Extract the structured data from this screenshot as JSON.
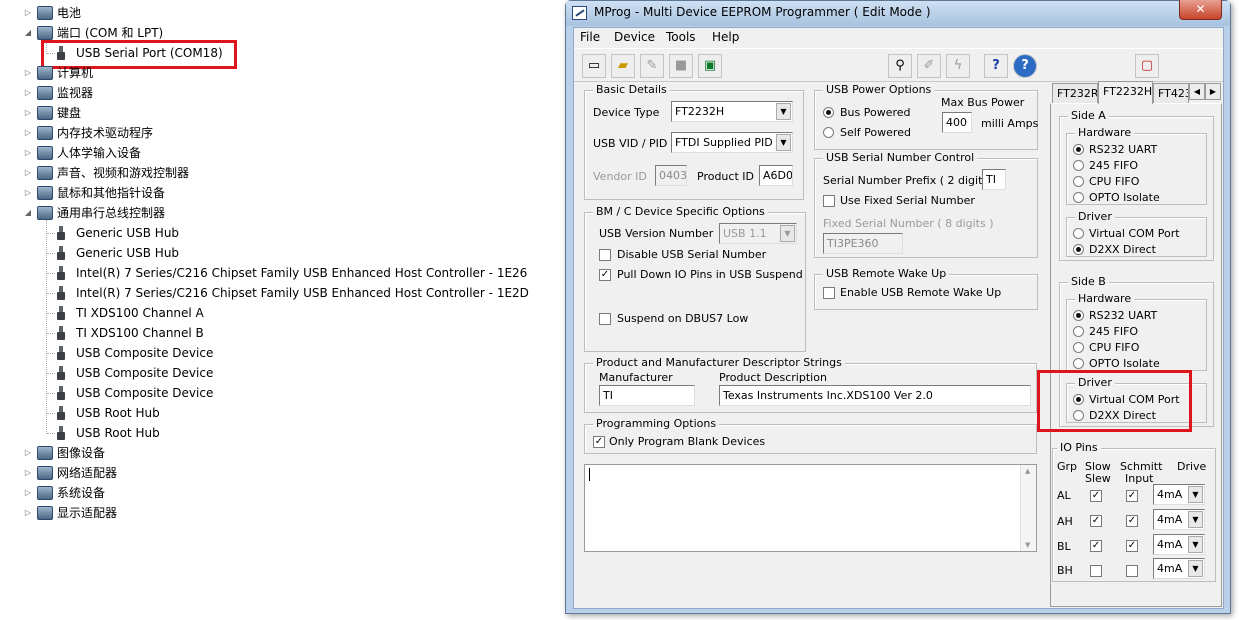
{
  "tree": {
    "rows": [
      {
        "label": "电池",
        "kind": "cat",
        "toggle": "▷"
      },
      {
        "label": "端口 (COM 和 LPT)",
        "kind": "cat",
        "toggle": "◢"
      },
      {
        "label": "USB Serial Port (COM18)",
        "kind": "dev"
      },
      {
        "label": "计算机",
        "kind": "cat",
        "toggle": "▷"
      },
      {
        "label": "监视器",
        "kind": "cat",
        "toggle": "▷"
      },
      {
        "label": "键盘",
        "kind": "cat",
        "toggle": "▷"
      },
      {
        "label": "内存技术驱动程序",
        "kind": "cat",
        "toggle": "▷"
      },
      {
        "label": "人体学输入设备",
        "kind": "cat",
        "toggle": "▷"
      },
      {
        "label": "声音、视频和游戏控制器",
        "kind": "cat",
        "toggle": "▷"
      },
      {
        "label": "鼠标和其他指针设备",
        "kind": "cat",
        "toggle": "▷"
      },
      {
        "label": "通用串行总线控制器",
        "kind": "cat",
        "toggle": "◢"
      },
      {
        "label": "Generic USB Hub",
        "kind": "dev"
      },
      {
        "label": "Generic USB Hub",
        "kind": "dev"
      },
      {
        "label": "Intel(R) 7 Series/C216 Chipset Family USB Enhanced Host Controller - 1E26",
        "kind": "dev"
      },
      {
        "label": "Intel(R) 7 Series/C216 Chipset Family USB Enhanced Host Controller - 1E2D",
        "kind": "dev"
      },
      {
        "label": "TI XDS100 Channel A",
        "kind": "dev"
      },
      {
        "label": "TI XDS100 Channel B",
        "kind": "dev"
      },
      {
        "label": "USB Composite Device",
        "kind": "dev"
      },
      {
        "label": "USB Composite Device",
        "kind": "dev"
      },
      {
        "label": "USB Composite Device",
        "kind": "dev"
      },
      {
        "label": "USB Root Hub",
        "kind": "dev"
      },
      {
        "label": "USB Root Hub",
        "kind": "dev"
      },
      {
        "label": "图像设备",
        "kind": "cat",
        "toggle": "▷"
      },
      {
        "label": "网络适配器",
        "kind": "cat",
        "toggle": "▷"
      },
      {
        "label": "系统设备",
        "kind": "cat",
        "toggle": "▷"
      },
      {
        "label": "显示适配器",
        "kind": "cat",
        "toggle": "▷"
      }
    ]
  },
  "window": {
    "title": "MProg - Multi Device EEPROM Programmer ( Edit Mode )",
    "close": "✕",
    "menu": [
      "File",
      "Device",
      "Tools",
      "Help"
    ],
    "toolbar": {
      "help": "?"
    }
  },
  "basic": {
    "title": "Basic Details",
    "device_type_label": "Device Type",
    "device_type": "FT2232H",
    "vidpid_label": "USB VID / PID",
    "vidpid": "FTDI Supplied PID",
    "vendor_label": "Vendor ID",
    "vendor_id": "0403",
    "product_label": "Product ID",
    "product_id": "A6D0"
  },
  "power": {
    "title": "USB Power Options",
    "bus_powered": "Bus Powered",
    "self_powered": "Self Powered",
    "max_power_label": "Max Bus Power",
    "max_power": "400",
    "unit": "milli Amps"
  },
  "serial": {
    "title": "USB Serial Number Control",
    "prefix_label": "Serial Number Prefix ( 2 digits )",
    "prefix": "TI",
    "use_fixed": "Use Fixed Serial Number",
    "fixed_label": "Fixed Serial Number ( 8 digits )",
    "fixed_value": "TI3PE360"
  },
  "bm": {
    "title": "BM / C Device Specific Options",
    "usb_version_label": "USB Version Number",
    "usb_version": "USB 1.1",
    "disable_serial": "Disable USB Serial Number",
    "pulldown": "Pull Down IO Pins in USB Suspend",
    "suspend": "Suspend on DBUS7 Low"
  },
  "wake": {
    "title": "USB Remote Wake Up",
    "enable": "Enable USB Remote Wake Up"
  },
  "strings": {
    "title": "Product and Manufacturer Descriptor Strings",
    "mfr_label": "Manufacturer",
    "mfr": "TI",
    "desc_label": "Product Description",
    "desc": "Texas Instruments Inc.XDS100 Ver 2.0"
  },
  "prog": {
    "title": "Programming Options",
    "only_blank": "Only Program Blank Devices"
  },
  "tabs": [
    "FT232R",
    "FT2232H",
    "FT423"
  ],
  "tab_scroll": {
    "left": "◀",
    "right": "▶"
  },
  "side_a": {
    "title": "Side A",
    "hw_title": "Hardware",
    "hw": [
      "RS232 UART",
      "245 FIFO",
      "CPU FIFO",
      "OPTO Isolate"
    ],
    "drv_title": "Driver",
    "drv": [
      "Virtual COM Port",
      "D2XX Direct"
    ]
  },
  "side_b": {
    "title": "Side B",
    "hw_title": "Hardware",
    "hw": [
      "RS232 UART",
      "245 FIFO",
      "CPU FIFO",
      "OPTO Isolate"
    ],
    "drv_title": "Driver",
    "drv": [
      "Virtual COM Port",
      "D2XX Direct"
    ]
  },
  "io": {
    "title": "IO Pins",
    "h_grp": "Grp",
    "h_slow1": "Slow",
    "h_slow2": "Slew",
    "h_sch1": "Schmitt",
    "h_sch2": "Input",
    "h_drive": "Drive",
    "rows": [
      {
        "grp": "AL",
        "drive": "4mA"
      },
      {
        "grp": "AH",
        "drive": "4mA"
      },
      {
        "grp": "BL",
        "drive": "4mA"
      },
      {
        "grp": "BH",
        "drive": "4mA"
      }
    ]
  },
  "colors": {
    "highlight": "#e0141b",
    "titlebar": "#b9d0e8"
  }
}
